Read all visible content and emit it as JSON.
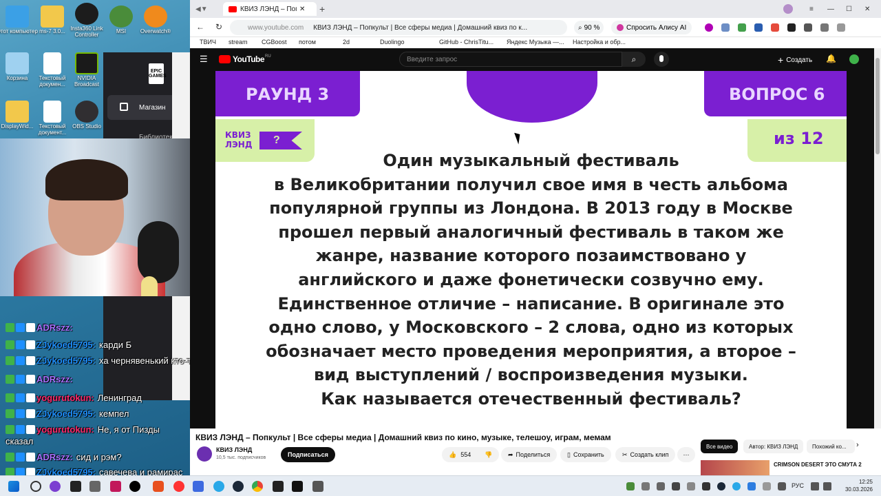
{
  "desktop": {
    "icons": [
      {
        "label": "Этот компьютер",
        "color": "#3ba0e6"
      },
      {
        "label": "ms-7 3.0...",
        "color": "#f2c84b"
      },
      {
        "label": "Insta360 Link Controller",
        "color": "#1c1c1c"
      },
      {
        "label": "MSI",
        "color": "#4a8c3a"
      },
      {
        "label": "Overwatch®",
        "color": "#f08a1c"
      },
      {
        "label": "Корзина",
        "color": "#9fd1f0"
      },
      {
        "label": "Текстовый докумен...",
        "color": "#ffffff"
      },
      {
        "label": "NVIDIA Broadcast",
        "color": "#76b900"
      },
      {
        "label": "DisplayWid...",
        "color": "#f2c84b"
      },
      {
        "label": "Текстовый документ...",
        "color": "#ffffff"
      },
      {
        "label": "OBS Studio",
        "color": "#302e31"
      }
    ]
  },
  "epic": {
    "logo": "EPIC GAMES",
    "store": "Магазин",
    "library": "Библиотека"
  },
  "chat": [
    {
      "user": "ADRszz:",
      "text": "",
      "color": "#a970ff"
    },
    {
      "user": "ZJykoed5795:",
      "text": "карди Б",
      "color": "#1e90ff"
    },
    {
      "user": "ZJykoed5795:",
      "text": "ха чернявенький кто-то",
      "color": "#1e90ff"
    },
    {
      "user": "ADRszz:",
      "text": "",
      "color": "#a970ff"
    },
    {
      "user": "yogurutokun:",
      "text": "Ленинград",
      "color": "#ff2a6d"
    },
    {
      "user": "ZJykoed5795:",
      "text": "кемпел",
      "color": "#1e90ff"
    },
    {
      "user": "yogurutokun:",
      "text": "Не, я от Пизды",
      "color": "#ff2a6d"
    },
    {
      "user": "",
      "text": "сказал",
      "color": "#ffffff"
    },
    {
      "user": "ADRszz:",
      "text": "сид и рэм?",
      "color": "#a970ff"
    },
    {
      "user": "ZJykoed5795:",
      "text": "савечева и рамирас",
      "color": "#1e90ff"
    }
  ],
  "browser": {
    "tab_title": "КВИЗ ЛЭНД – Попкульт",
    "address_host": "www.youtube.com",
    "page_title": "КВИЗ ЛЭНД – Попкульт | Все сферы медиа | Домашний квиз по к...",
    "zoom": "90 %",
    "alice": "Спросить Алису AI",
    "bookmarks": [
      "ТВИЧ",
      "stream",
      "CGBoost",
      "потом",
      "2d",
      "Duolingo",
      "GitHub - ChrisTitu...",
      "Яндекс Музыка —...",
      "Настройка и обр..."
    ]
  },
  "youtube": {
    "logo": "YouTube",
    "region": "RU",
    "search_placeholder": "Введите запрос",
    "create": "Создать",
    "video": {
      "round": "РАУНД 3",
      "question": "ВОПРОС 6",
      "of": "из 12",
      "brand_line1": "КВИЗ",
      "brand_line2": "ЛЭНД",
      "lines": [
        "Один музыкальный фестиваль",
        "в Великобритании получил свое имя в честь альбома",
        "популярной группы из Лондона. В 2013 году в Москве",
        "прошел первый аналогичный фестиваль в таком же",
        "жанре, название которого позаимствовано у",
        "английского и даже фонетически созвучно ему.",
        "Единственное отличие – написание. В оригинале это",
        "одно слово, у Московского – 2 слова, одно из которых",
        "обозначает место проведения мероприятия, а второе –",
        "вид выступлений / воспроизведения музыки.",
        "Как называется отечественный фестиваль?"
      ]
    },
    "title": "КВИЗ ЛЭНД – Попкульт | Все сферы медиа | Домашний квиз по кино, музыке, телешоу, играм, мемам",
    "channel": "КВИЗ ЛЭНД",
    "subscribers": "10,5 тыс. подписчиков",
    "subscribe": "Подписаться",
    "likes": "554",
    "share": "Поделиться",
    "save": "Сохранить",
    "clip": "Создать клип",
    "chips": [
      "Все видео",
      "Автор: КВИЗ ЛЭНД",
      "Похожий ко..."
    ],
    "suggested_title": "CRIMSON DESERT ЭТО СМУТА 2"
  },
  "taskbar": {
    "lang": "РУС",
    "time": "12:25",
    "date": "30.03.2026"
  },
  "colors": {
    "purple": "#7b1fd1",
    "green": "#d7f0a8",
    "youtube_red": "#ff0000"
  }
}
